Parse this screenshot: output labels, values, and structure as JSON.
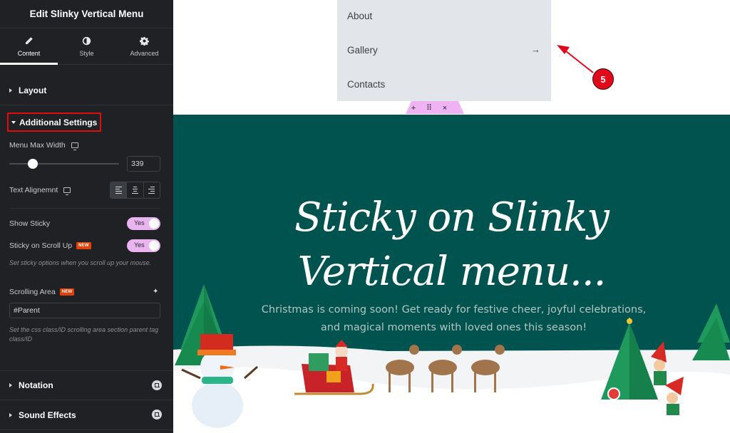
{
  "panel": {
    "title": "Edit Slinky Vertical Menu",
    "tabs": [
      {
        "label": "Content",
        "icon": "pencil-icon",
        "active": true
      },
      {
        "label": "Style",
        "icon": "half-circle-icon",
        "active": false
      },
      {
        "label": "Advanced",
        "icon": "gear-icon",
        "active": false
      }
    ],
    "sections": {
      "layout": "Layout",
      "additional_settings": "Additional Settings",
      "notation": "Notation",
      "sound_effects": "Sound Effects"
    },
    "controls": {
      "menu_max_width_label": "Menu Max Width",
      "menu_max_width_value": "339",
      "text_alignment_label": "Text Alignemnt",
      "text_alignment_options": [
        "left",
        "center",
        "right"
      ],
      "text_alignment_selected": "left",
      "show_sticky_label": "Show Sticky",
      "show_sticky_value": "Yes",
      "sticky_scroll_up_label": "Sticky on Scroll Up",
      "sticky_scroll_up_value": "Yes",
      "sticky_hint": "Set sticky options when you scroll up your mouse.",
      "scrolling_area_label": "Scrolling Area",
      "scrolling_area_value": "#Parent",
      "scrolling_area_hint": "Set the css class/ID scrolling area section parent tag class/ID",
      "new_badge": "NEW"
    }
  },
  "canvas": {
    "menu_items": [
      "About",
      "Gallery",
      "Contacts"
    ],
    "menu_arrow": "→",
    "handle": {
      "add": "+",
      "drag": "⠿",
      "close": "×"
    },
    "annotation_number": "5",
    "hero": {
      "title_line1": "Sticky on Slinky",
      "title_line2": "Vertical menu...",
      "subtitle": "Christmas is coming soon! Get ready for festive cheer, joyful celebrations, and magical moments with loved ones this season!"
    }
  },
  "colors": {
    "panel_bg": "#1f2124",
    "toggle_on": "#e9b4f0",
    "new_badge": "#e2410b",
    "highlight_box": "#e00d0d",
    "hero_bg": "#00534f",
    "menu_bg": "#e2e6ea",
    "annotation": "#e0081a"
  }
}
